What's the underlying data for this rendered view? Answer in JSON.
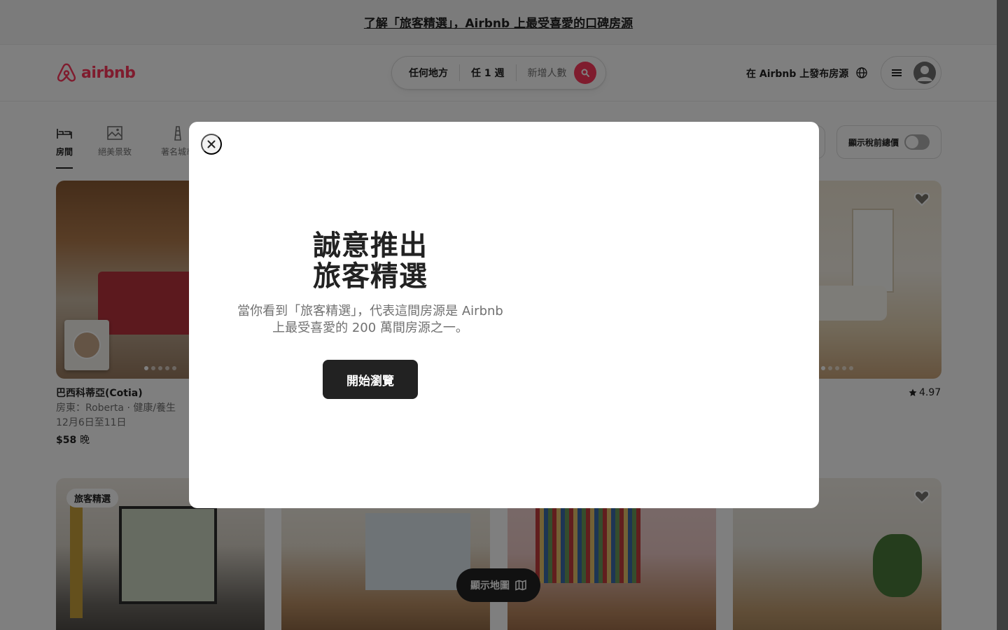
{
  "banner": {
    "text": "了解「旅客精選」，Airbnb 上最受喜愛的口碑房源"
  },
  "header": {
    "logo_text": "airbnb",
    "search": {
      "location": "任何地方",
      "dates": "任 1 週",
      "guests": "新增人數"
    },
    "host_link": "在 Airbnb 上發布房源"
  },
  "categories": [
    {
      "label": "房間",
      "icon": "bed-icon",
      "active": true
    },
    {
      "label": "絕美景致",
      "icon": "landscape-icon",
      "active": false
    },
    {
      "label": "著名城市",
      "icon": "tower-icon",
      "active": false
    }
  ],
  "tax_toggle_label": "顯示稅前總價",
  "listings": [
    {
      "title": "巴西科蒂亞(Cotia)",
      "host": "房東：Roberta · 健康/養生",
      "dates": "12月6日至11日",
      "price": "$58",
      "unit": "晚"
    }
  ],
  "rating": "4.97",
  "guest_favorite_badge": "旅客精選",
  "map_button": "顯示地圖",
  "modal": {
    "title_line1": "誠意推出",
    "title_line2": "旅客精選",
    "description": "當你看到「旅客精選」，代表這間房源是 Airbnb 上最受喜愛的 200 萬間房源之一。",
    "cta": "開始瀏覽"
  },
  "colors": {
    "brand": "#ff385c",
    "text": "#222222",
    "muted": "#717171"
  }
}
